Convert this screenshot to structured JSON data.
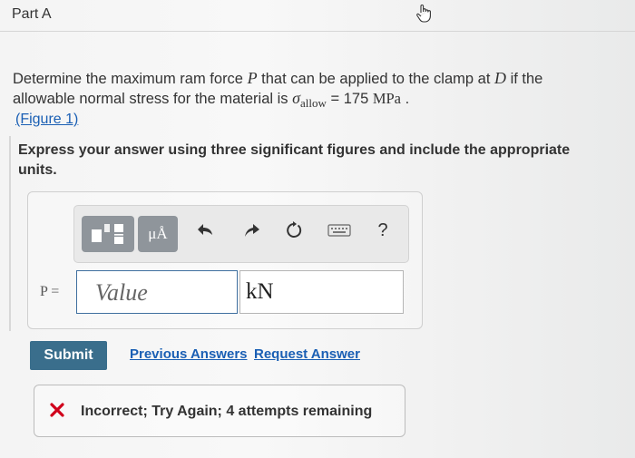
{
  "part": {
    "title": "Part A"
  },
  "problem": {
    "line1_prefix": "Determine the maximum ram force ",
    "var_P": "P",
    "line1_mid": " that can be applied to the clamp at ",
    "var_D": "D",
    "line1_suffix": " if the",
    "line2_prefix": "allowable normal stress for the material is ",
    "sigma": "σ",
    "sigma_sub": "allow",
    "equals": " = 175 ",
    "unit": "MPa",
    "period": " ."
  },
  "figure_link": "(Figure 1)",
  "instructions": "Express your answer using three significant figures and include the appropriate units.",
  "toolbar": {
    "buttons": [
      {
        "icon": "templates-icon"
      },
      {
        "icon": "units-icon",
        "label": "μÅ"
      },
      {
        "icon": "undo-icon"
      },
      {
        "icon": "redo-icon"
      },
      {
        "icon": "reset-icon"
      },
      {
        "icon": "keyboard-icon"
      },
      {
        "icon": "help-icon",
        "label": "?"
      }
    ]
  },
  "answer": {
    "label": "P =",
    "value": "",
    "placeholder": "Value",
    "units": "kN"
  },
  "actions": {
    "submit": "Submit",
    "previous_answers": "Previous Answers",
    "request_answer": "Request Answer"
  },
  "feedback": {
    "text": "Incorrect; Try Again; 4 attempts remaining",
    "status_color": "#d0021b"
  },
  "colors": {
    "accent": "#3a6e8c",
    "link": "#1a5fb4",
    "input_border": "#3f6f9f"
  }
}
